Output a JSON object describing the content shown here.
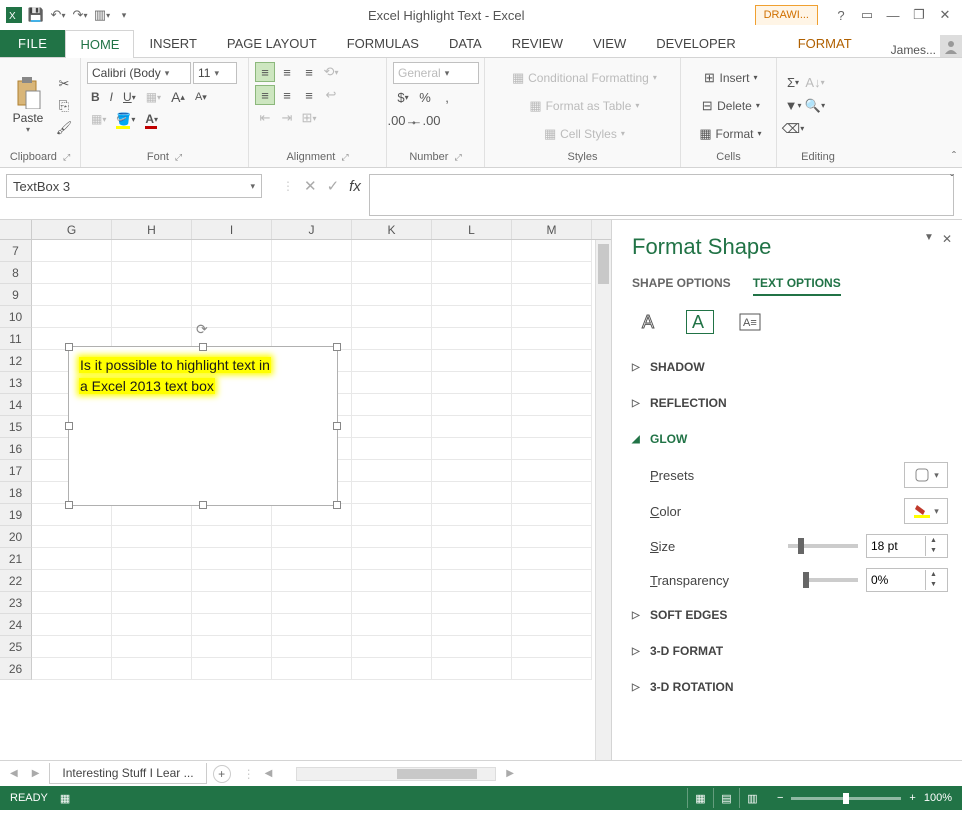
{
  "titlebar": {
    "app_title": "Excel Highlight Text - Excel",
    "context_tab": "DRAWI...",
    "username": "James...",
    "qat_icons": [
      "excel",
      "save",
      "undo",
      "redo",
      "gallery",
      "customize"
    ]
  },
  "tabs": {
    "file": "FILE",
    "items": [
      "HOME",
      "INSERT",
      "PAGE LAYOUT",
      "FORMULAS",
      "DATA",
      "REVIEW",
      "VIEW",
      "DEVELOPER"
    ],
    "active": "HOME",
    "context": "FORMAT"
  },
  "ribbon": {
    "clipboard": {
      "paste": "Paste",
      "label": "Clipboard"
    },
    "font": {
      "family": "Calibri (Body",
      "size": "11",
      "label": "Font"
    },
    "alignment": {
      "label": "Alignment"
    },
    "number": {
      "format": "General",
      "label": "Number"
    },
    "styles": {
      "conditional": "Conditional Formatting",
      "table": "Format as Table",
      "cell": "Cell Styles",
      "label": "Styles"
    },
    "cells": {
      "insert": "Insert",
      "delete": "Delete",
      "format": "Format",
      "label": "Cells"
    },
    "editing": {
      "label": "Editing"
    }
  },
  "namebox": "TextBox 3",
  "grid": {
    "cols": [
      "G",
      "H",
      "I",
      "J",
      "K",
      "L",
      "M"
    ],
    "rows": [
      7,
      8,
      9,
      10,
      11,
      12,
      13,
      14,
      15,
      16,
      17,
      18,
      19,
      20,
      21,
      22,
      23,
      24,
      25,
      26
    ]
  },
  "shape": {
    "line1": "Is it possible to highlight text in",
    "line2": "a Excel 2013 text box"
  },
  "pane": {
    "title": "Format Shape",
    "tab1": "SHAPE OPTIONS",
    "tab2": "TEXT OPTIONS",
    "sections": {
      "shadow": "SHADOW",
      "reflection": "REFLECTION",
      "glow": "GLOW",
      "soft_edges": "SOFT EDGES",
      "format3d": "3-D FORMAT",
      "rotation3d": "3-D ROTATION"
    },
    "glow": {
      "presets": "Presets",
      "color": "Color",
      "size": "Size",
      "size_val": "18 pt",
      "transparency": "Transparency",
      "transparency_val": "0%"
    }
  },
  "sheet_tabs": {
    "name": "Interesting Stuff I Lear ..."
  },
  "statusbar": {
    "ready": "READY",
    "zoom": "100%"
  }
}
